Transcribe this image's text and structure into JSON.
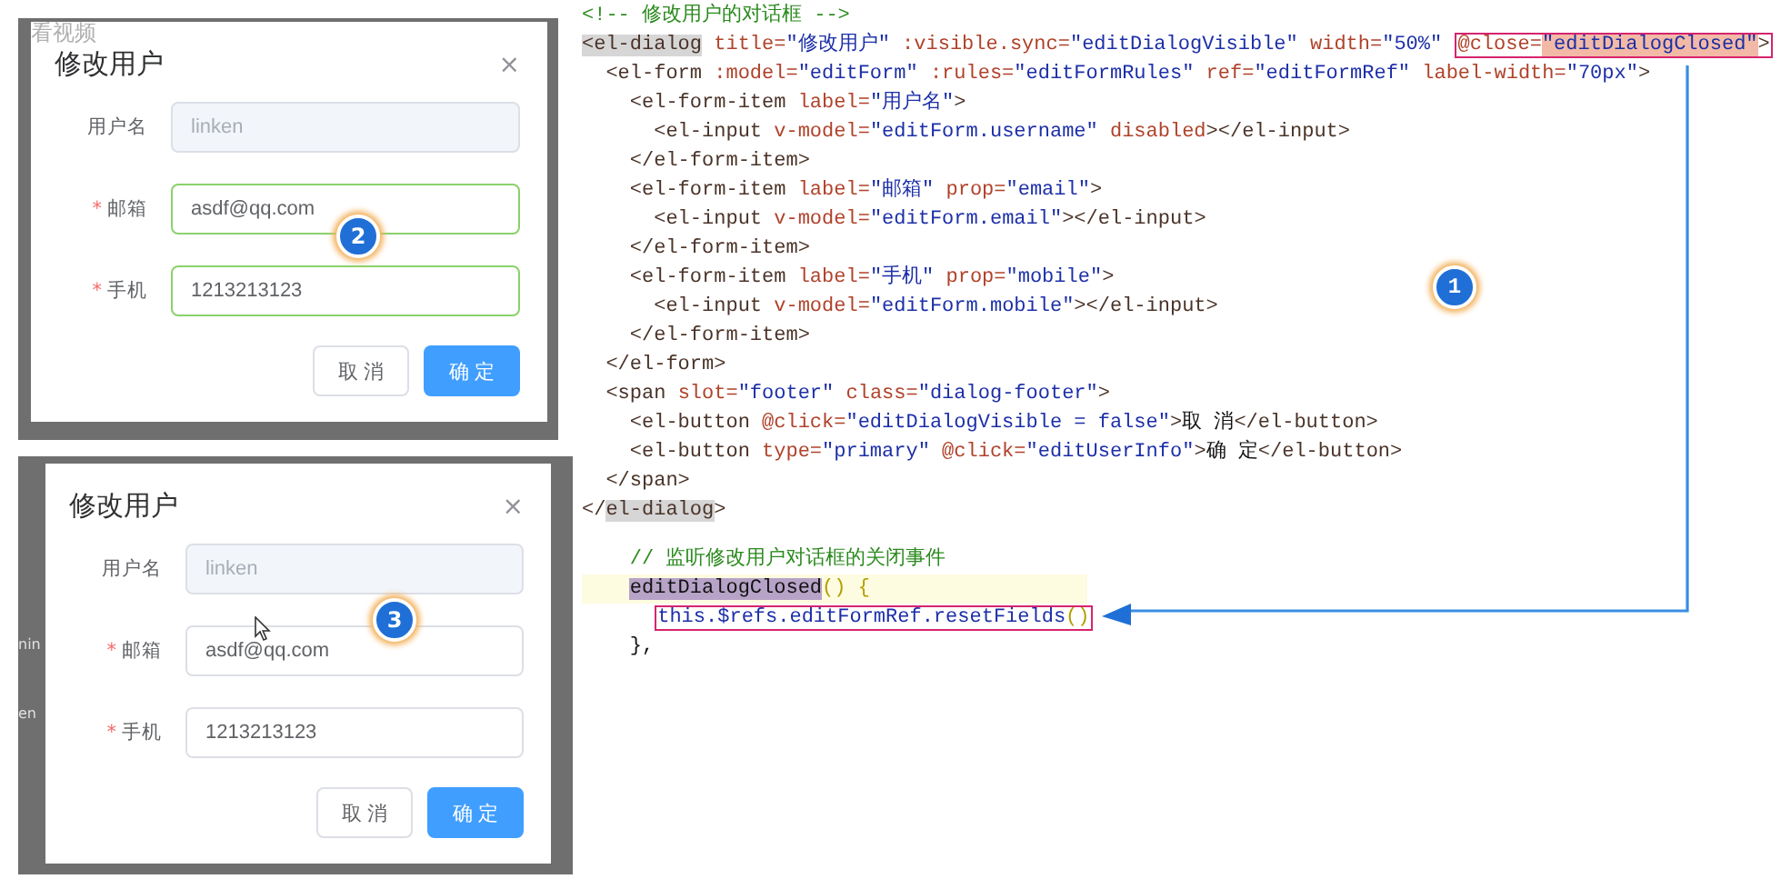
{
  "dialogs": [
    {
      "top_fragment": "看视频",
      "title": "修改用户",
      "close": "×",
      "badge": "2",
      "cursor": false,
      "fields": [
        {
          "label": "用户名",
          "value": "linken",
          "disabled": true,
          "valid": false
        },
        {
          "label": "邮箱",
          "mark": "*",
          "value": "asdf@qq.com",
          "disabled": false,
          "valid": true
        },
        {
          "label": "手机",
          "mark": "*",
          "value": "1213213123",
          "disabled": false,
          "valid": true
        }
      ],
      "buttons": [
        {
          "label": "取 消",
          "kind": "default"
        },
        {
          "label": "确 定",
          "kind": "primary"
        }
      ]
    },
    {
      "side_fragments": [
        "nin",
        "en"
      ],
      "title": "修改用户",
      "close": "×",
      "badge": "3",
      "cursor": true,
      "fields": [
        {
          "label": "用户名",
          "value": "linken",
          "disabled": true,
          "valid": false
        },
        {
          "label": "邮箱",
          "mark": "*",
          "value": "asdf@qq.com",
          "disabled": false,
          "valid": false
        },
        {
          "label": "手机",
          "mark": "*",
          "value": "1213213123",
          "disabled": false,
          "valid": false
        }
      ],
      "buttons": [
        {
          "label": "取 消",
          "kind": "default"
        },
        {
          "label": "确 定",
          "kind": "primary"
        }
      ]
    }
  ],
  "code": {
    "badge": "1",
    "lines": [
      {
        "tokens": [
          {
            "kind": "comment",
            "t": "<!-- 修改用户的对话框 -->"
          }
        ]
      },
      {
        "tokens": [
          {
            "kind": "tag",
            "t": "<el-dialog",
            "highlighted": true
          },
          {
            "kind": "attr",
            "t": " title="
          },
          {
            "kind": "str",
            "t": "\"修改用户\""
          },
          {
            "kind": "attr",
            "t": " :visible.sync="
          },
          {
            "kind": "str",
            "t": "\"editDialogVisible\""
          },
          {
            "kind": "attr",
            "t": " width="
          },
          {
            "kind": "str",
            "t": "\"50%\""
          },
          {
            "kind": "attr",
            "t": " @close=",
            "boxed": true
          },
          {
            "kind": "str",
            "t": "\"editDialogClosed\"",
            "boxed": true,
            "highlighted": true
          },
          {
            "kind": "tag",
            "t": ">",
            "boxed": true
          }
        ]
      },
      {
        "tokens": [
          {
            "kind": "tag",
            "t": "  <el-form"
          },
          {
            "kind": "attr",
            "t": " :model="
          },
          {
            "kind": "str",
            "t": "\"editForm\""
          },
          {
            "kind": "attr",
            "t": " :rules="
          },
          {
            "kind": "str",
            "t": "\"editFormRules\""
          },
          {
            "kind": "attr",
            "t": " ref="
          },
          {
            "kind": "str",
            "t": "\"editFormRef\""
          },
          {
            "kind": "attr",
            "t": " label-width="
          },
          {
            "kind": "str",
            "t": "\"70px\""
          },
          {
            "kind": "tag",
            "t": ">"
          }
        ]
      },
      {
        "tokens": [
          {
            "kind": "tag",
            "t": "    <el-form-item"
          },
          {
            "kind": "attr",
            "t": " label="
          },
          {
            "kind": "str",
            "t": "\"用户名\""
          },
          {
            "kind": "tag",
            "t": ">"
          }
        ]
      },
      {
        "tokens": [
          {
            "kind": "tag",
            "t": "      <el-input"
          },
          {
            "kind": "attr",
            "t": " v-model="
          },
          {
            "kind": "str",
            "t": "\"editForm.username\""
          },
          {
            "kind": "attr",
            "t": " disabled"
          },
          {
            "kind": "tag",
            "t": "></el-input>"
          }
        ]
      },
      {
        "tokens": [
          {
            "kind": "tag",
            "t": "    </el-form-item>"
          }
        ]
      },
      {
        "tokens": [
          {
            "kind": "tag",
            "t": "    <el-form-item"
          },
          {
            "kind": "attr",
            "t": " label="
          },
          {
            "kind": "str",
            "t": "\"邮箱\""
          },
          {
            "kind": "attr",
            "t": " prop="
          },
          {
            "kind": "str",
            "t": "\"email\""
          },
          {
            "kind": "tag",
            "t": ">"
          }
        ]
      },
      {
        "tokens": [
          {
            "kind": "tag",
            "t": "      <el-input"
          },
          {
            "kind": "attr",
            "t": " v-model="
          },
          {
            "kind": "str",
            "t": "\"editForm.email\""
          },
          {
            "kind": "tag",
            "t": "></el-input>"
          }
        ]
      },
      {
        "tokens": [
          {
            "kind": "tag",
            "t": "    </el-form-item>"
          }
        ]
      },
      {
        "tokens": [
          {
            "kind": "tag",
            "t": "    <el-form-item"
          },
          {
            "kind": "attr",
            "t": " label="
          },
          {
            "kind": "str",
            "t": "\"手机\""
          },
          {
            "kind": "attr",
            "t": " prop="
          },
          {
            "kind": "str",
            "t": "\"mobile\""
          },
          {
            "kind": "tag",
            "t": ">"
          }
        ]
      },
      {
        "tokens": [
          {
            "kind": "tag",
            "t": "      <el-input"
          },
          {
            "kind": "attr",
            "t": " v-model="
          },
          {
            "kind": "str",
            "t": "\"editForm.mobile\""
          },
          {
            "kind": "tag",
            "t": "></el-input>"
          }
        ]
      },
      {
        "tokens": [
          {
            "kind": "tag",
            "t": "    </el-form-item>"
          }
        ]
      },
      {
        "tokens": [
          {
            "kind": "tag",
            "t": "  </el-form>"
          }
        ]
      },
      {
        "tokens": [
          {
            "kind": "tag",
            "t": "  <span"
          },
          {
            "kind": "attr",
            "t": " slot="
          },
          {
            "kind": "str",
            "t": "\"footer\""
          },
          {
            "kind": "attr",
            "t": " class="
          },
          {
            "kind": "str",
            "t": "\"dialog-footer\""
          },
          {
            "kind": "tag",
            "t": ">"
          }
        ]
      },
      {
        "tokens": [
          {
            "kind": "tag",
            "t": "    <el-button"
          },
          {
            "kind": "attr",
            "t": " @click="
          },
          {
            "kind": "str",
            "t": "\"editDialogVisible = false\""
          },
          {
            "kind": "tag",
            "t": ">"
          },
          {
            "kind": "text",
            "t": "取 消"
          },
          {
            "kind": "tag",
            "t": "</el-button>"
          }
        ]
      },
      {
        "tokens": [
          {
            "kind": "tag",
            "t": "    <el-button"
          },
          {
            "kind": "attr",
            "t": " type="
          },
          {
            "kind": "str",
            "t": "\"primary\""
          },
          {
            "kind": "attr",
            "t": " @click="
          },
          {
            "kind": "str",
            "t": "\"editUserInfo\""
          },
          {
            "kind": "tag",
            "t": ">"
          },
          {
            "kind": "text",
            "t": "确 定"
          },
          {
            "kind": "tag",
            "t": "</el-button>"
          }
        ]
      },
      {
        "tokens": [
          {
            "kind": "tag",
            "t": "  </span>"
          }
        ]
      },
      {
        "tokens": [
          {
            "kind": "tag",
            "t": "</"
          },
          {
            "kind": "tag",
            "t": "el-dialog",
            "highlighted": true
          },
          {
            "kind": "tag",
            "t": ">"
          }
        ]
      },
      {
        "gap_before": true,
        "tokens": [
          {
            "kind": "comment",
            "t": "    // 监听修改用户对话框的关闭事件"
          }
        ]
      },
      {
        "highlighted": true,
        "tokens": [
          {
            "kind": "text",
            "t": "    editDialogClosed",
            "highlighted": true
          },
          {
            "kind": "punct",
            "t": "() {"
          }
        ]
      },
      {
        "tokens": [
          {
            "kind": "str",
            "t": "      this.$refs.editFormRef.resetFields",
            "boxed": true
          },
          {
            "kind": "punct",
            "t": "()",
            "boxed": true
          }
        ]
      },
      {
        "tokens": [
          {
            "kind": "text",
            "t": "    },"
          }
        ]
      }
    ]
  }
}
